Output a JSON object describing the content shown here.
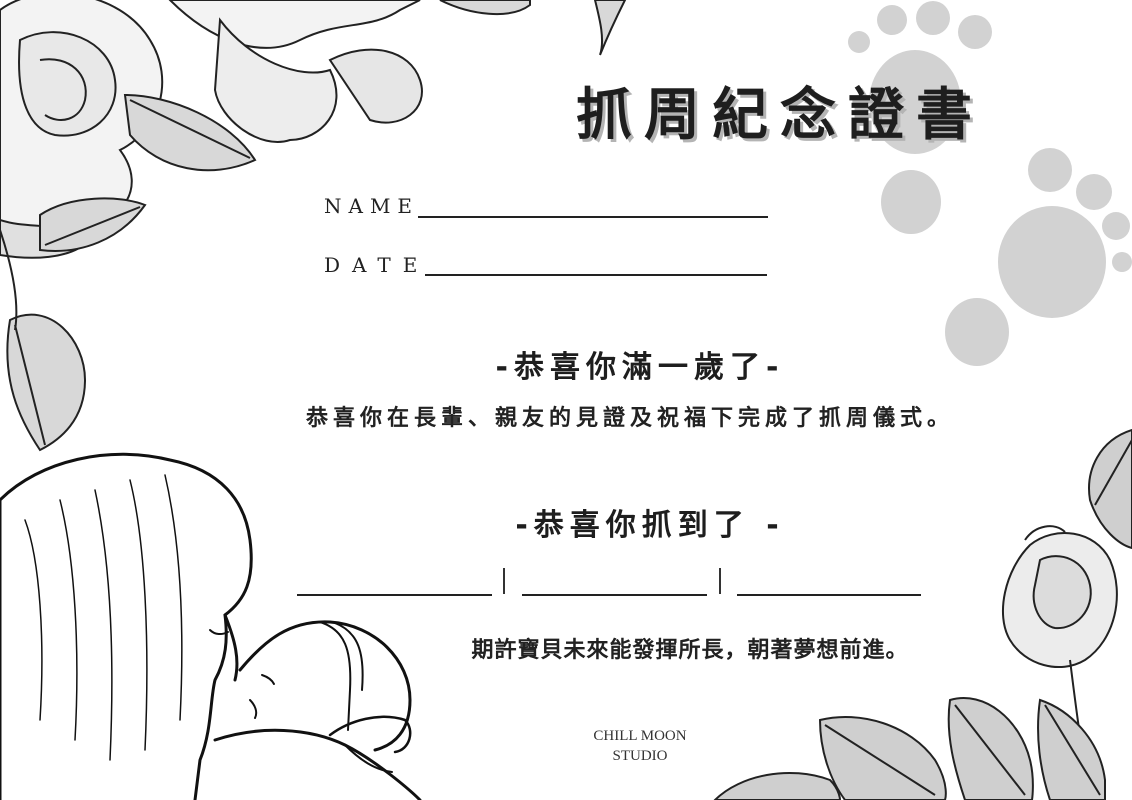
{
  "certificate": {
    "title": "抓周紀念證書",
    "name_label": "NAME",
    "date_label": "DATE",
    "heading_1": "-恭喜你滿一歲了-",
    "body": "恭喜你在長輩、親友的見證及祝福下完成了抓周儀式。",
    "heading_2": "-恭喜你抓到了 -",
    "closing": "期許寶貝未來能發揮所長，朝著夢想前進。"
  },
  "logo": {
    "line_1": "CHILL MOON",
    "line_2": "STUDIO"
  },
  "colors": {
    "background": "#ffffff",
    "text": "#1e1e1e",
    "title_shadow": "#b4b4b4",
    "paw_print": "#d2d2d2"
  },
  "icons": [
    "flower-illustration",
    "leaf-illustration",
    "paw-print-icon",
    "mother-baby-illustration",
    "rose-illustration",
    "moon-icon"
  ]
}
